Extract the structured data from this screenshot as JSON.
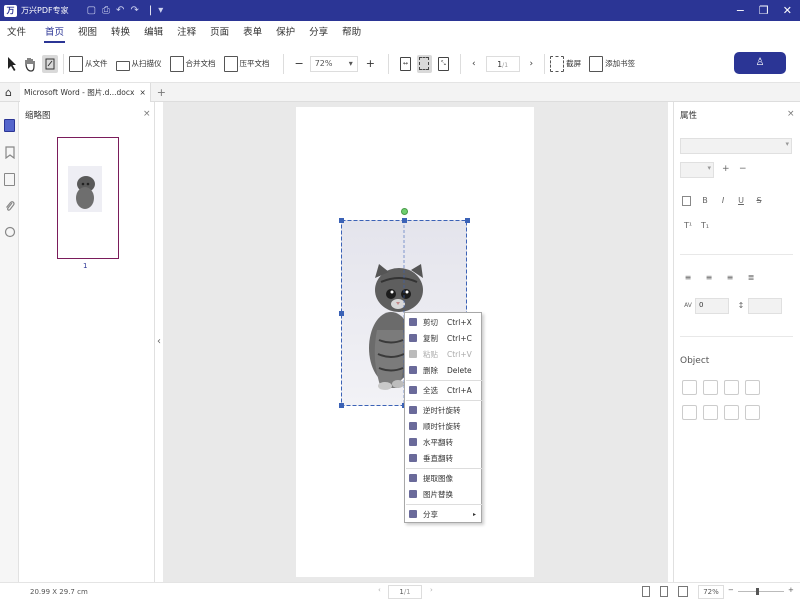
{
  "titlebar": {
    "logo_text": "万",
    "app_name": "万兴PDF专家",
    "save_icon": "save-icon",
    "print_icon": "print-icon",
    "undo_icon": "undo-icon",
    "redo_icon": "redo-icon",
    "menu_icon": "dropdown-icon"
  },
  "menu": {
    "file": "文件",
    "tabs": [
      "首页",
      "视图",
      "转换",
      "编辑",
      "注释",
      "页面",
      "表单",
      "保护",
      "分享",
      "帮助"
    ],
    "active": 0
  },
  "toolbar": {
    "from_file": "从文件",
    "from_scanner": "从扫描仪",
    "merge": "合并文档",
    "compress": "压平文档",
    "zoom": "72%",
    "zoom_out": "−",
    "zoom_in": "+",
    "page": "1",
    "page_total": "/1",
    "screenshot": "截屏",
    "bookmark": "添加书签"
  },
  "tabs": [
    {
      "label": "Microsoft Word - 图片.d...docx",
      "close": "×"
    }
  ],
  "tab_add": "+",
  "thumbnails": {
    "title": "缩略图",
    "close": "×",
    "page_num": "1"
  },
  "properties": {
    "title": "属性",
    "close": "×",
    "object_label": "Object",
    "font_size_plus": "+",
    "font_size_minus": "−",
    "spacing_value": "0"
  },
  "context_menu": [
    {
      "label": "剪切",
      "shortcut": "Ctrl+X",
      "disabled": false
    },
    {
      "label": "复制",
      "shortcut": "Ctrl+C",
      "disabled": false
    },
    {
      "label": "粘贴",
      "shortcut": "Ctrl+V",
      "disabled": true
    },
    {
      "label": "删除",
      "shortcut": "Delete",
      "disabled": false
    },
    {
      "label": "全选",
      "shortcut": "Ctrl+A",
      "disabled": false
    },
    {
      "label": "逆时针旋转",
      "shortcut": "",
      "disabled": false
    },
    {
      "label": "顺时针旋转",
      "shortcut": "",
      "disabled": false
    },
    {
      "label": "水平翻转",
      "shortcut": "",
      "disabled": false
    },
    {
      "label": "垂直翻转",
      "shortcut": "",
      "disabled": false
    },
    {
      "label": "提取图像",
      "shortcut": "",
      "disabled": false
    },
    {
      "label": "图片替换",
      "shortcut": "",
      "disabled": false
    },
    {
      "label": "分享",
      "shortcut": "",
      "disabled": false,
      "submenu": "▸"
    }
  ],
  "status": {
    "page_size": "20.99 X 29.7 cm",
    "page": "1",
    "page_total": "/1",
    "zoom": "72%"
  },
  "colors": {
    "brand": "#2b3595",
    "thumb_border": "#7a1c5b",
    "selection": "#3b62b6",
    "rotate_handle": "#6fcf6f"
  }
}
